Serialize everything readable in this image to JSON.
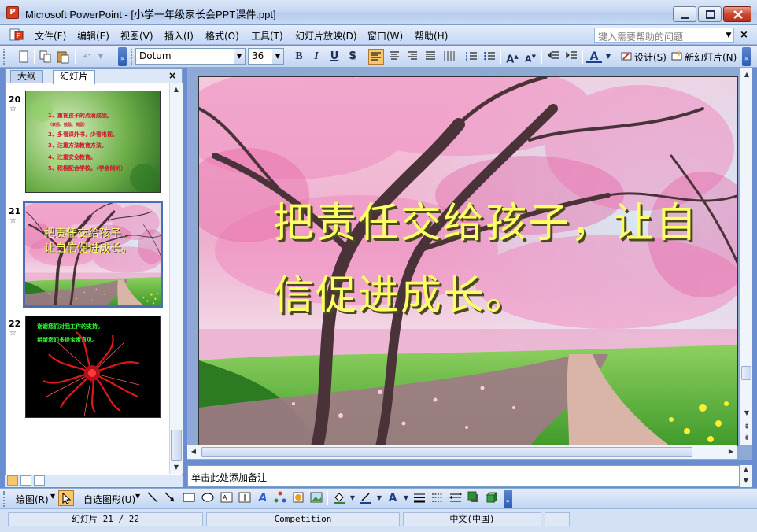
{
  "window": {
    "title": "Microsoft PowerPoint - [小学一年级家长会PPT课件.ppt]",
    "app_icon": "powerpoint-icon",
    "controls": [
      "minimize-icon",
      "maximize-icon",
      "close-icon"
    ]
  },
  "menubar": {
    "items": [
      "文件(F)",
      "编辑(E)",
      "视图(V)",
      "插入(I)",
      "格式(O)",
      "工具(T)",
      "幻灯片放映(D)",
      "窗口(W)",
      "帮助(H)"
    ],
    "help_placeholder": "键入需要帮助的问题"
  },
  "toolbar": {
    "font_name": "Dotum",
    "font_size": "36",
    "bold": "B",
    "italic": "I",
    "underline": "U",
    "shadow": "S",
    "design_label": "设计(S)",
    "new_slide_label": "新幻灯片(N)"
  },
  "left_pane": {
    "tabs": [
      "大纲",
      "幻灯片"
    ],
    "active_tab": "幻灯片",
    "thumbnails": [
      {
        "number": "20",
        "lines": [
          "1、重视孩子的点滴成绩。",
          "（表扬、鼓励、奖励）",
          "2、多看课外书，少看电视。",
          "3、注重方法教育方法。",
          "4、注重安全教育。",
          "5、积极配合学校。（学会倾听）"
        ]
      },
      {
        "number": "21",
        "text": "把责任交给孩子，让自信促进成长。",
        "selected": true
      },
      {
        "number": "22",
        "lines": [
          "谢谢您们对我工作的支持。",
          "希望您们多提宝贵意见。"
        ]
      }
    ]
  },
  "slide": {
    "title": "把责任交给孩子，让自信促进成长。",
    "title_color": "#ffff66",
    "background": "cherry-blossom-path"
  },
  "notes": {
    "placeholder": "单击此处添加备注"
  },
  "drawbar": {
    "draw_label": "绘图(R)",
    "autoshapes_label": "自选图形(U)"
  },
  "statusbar": {
    "slide_pos": "幻灯片 21 / 22",
    "template": "Competition",
    "language": "中文(中国)"
  },
  "colors": {
    "chrome_blue": "#c3d6f1",
    "accent_orange": "#f8c76a",
    "close_red": "#c9482f"
  }
}
